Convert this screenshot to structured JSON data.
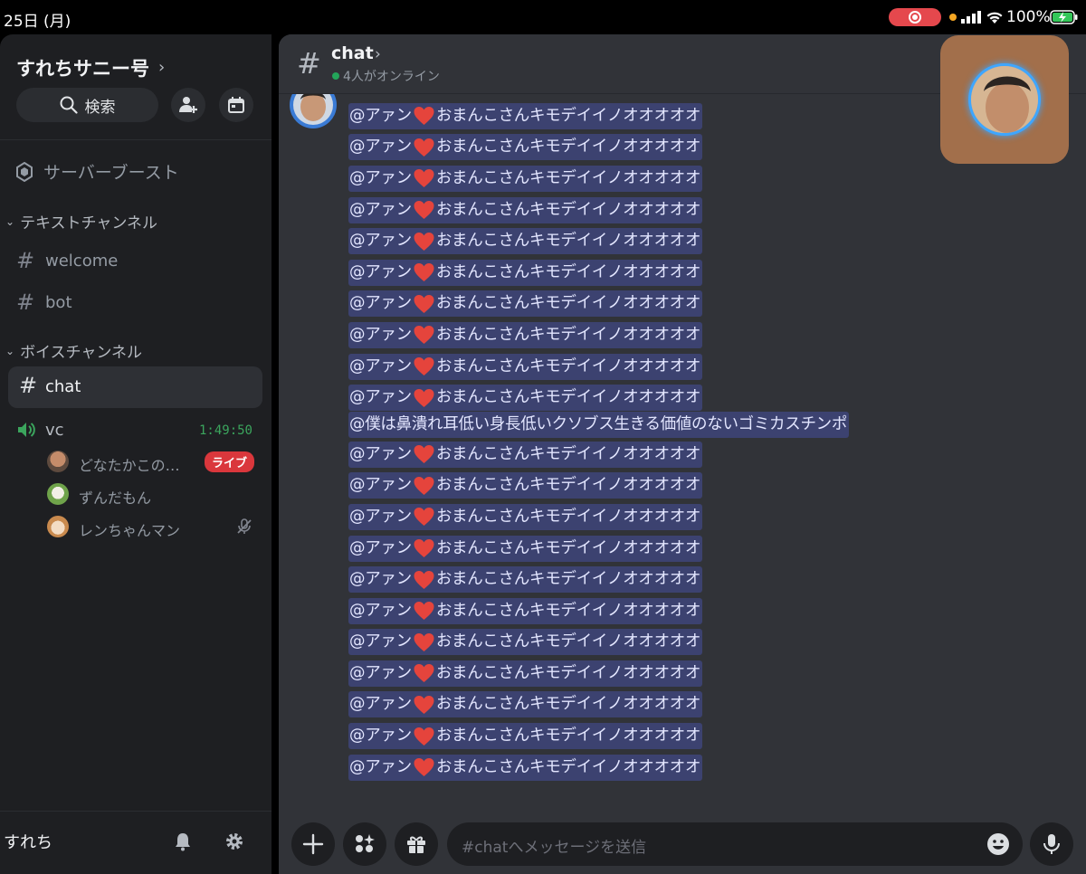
{
  "status_bar": {
    "date": "25日 (月)",
    "battery": "100%"
  },
  "sidebar": {
    "server_name": "すれちサニー号",
    "search_label": "検索",
    "boost_label": "サーバーブースト",
    "text_category": "テキストチャンネル",
    "voice_category": "ボイスチャンネル",
    "text_channels": [
      {
        "label": "welcome"
      },
      {
        "label": "bot"
      }
    ],
    "active_channel": "chat",
    "voice_channel": {
      "label": "vc",
      "timer": "1:49:50"
    },
    "voice_users": [
      {
        "name": "どなたかこの…",
        "badge": "ライブ"
      },
      {
        "name": "ずんだもん"
      },
      {
        "name": "レンちゃんマン"
      }
    ],
    "username": "すれち"
  },
  "chat": {
    "title": "chat",
    "online": "4人がオンライン",
    "messages": [
      {
        "prefix": "@アァン",
        "heart": true,
        "suffix": "おまんこさんキモデイイノオオオオオ"
      },
      {
        "prefix": "@アァン",
        "heart": true,
        "suffix": "おまんこさんキモデイイノオオオオオ"
      },
      {
        "prefix": "@アァン",
        "heart": true,
        "suffix": "おまんこさんキモデイイノオオオオオ"
      },
      {
        "prefix": "@アァン",
        "heart": true,
        "suffix": "おまんこさんキモデイイノオオオオオ"
      },
      {
        "prefix": "@アァン",
        "heart": true,
        "suffix": "おまんこさんキモデイイノオオオオオ"
      },
      {
        "prefix": "@アァン",
        "heart": true,
        "suffix": "おまんこさんキモデイイノオオオオオ"
      },
      {
        "prefix": "@アァン",
        "heart": true,
        "suffix": "おまんこさんキモデイイノオオオオオ"
      },
      {
        "prefix": "@アァン",
        "heart": true,
        "suffix": "おまんこさんキモデイイノオオオオオ"
      },
      {
        "prefix": "@アァン",
        "heart": true,
        "suffix": "おまんこさんキモデイイノオオオオオ"
      },
      {
        "prefix": "@アァン",
        "heart": true,
        "suffix": "おまんこさんキモデイイノオオオオオ"
      },
      {
        "prefix": "@僕は鼻潰れ耳低い身長低いクソブス生きる価値のないゴミカスチンポ",
        "heart": false,
        "suffix": ""
      },
      {
        "prefix": "@アァン",
        "heart": true,
        "suffix": "おまんこさんキモデイイノオオオオオ"
      },
      {
        "prefix": "@アァン",
        "heart": true,
        "suffix": "おまんこさんキモデイイノオオオオオ"
      },
      {
        "prefix": "@アァン",
        "heart": true,
        "suffix": "おまんこさんキモデイイノオオオオオ"
      },
      {
        "prefix": "@アァン",
        "heart": true,
        "suffix": "おまんこさんキモデイイノオオオオオ"
      },
      {
        "prefix": "@アァン",
        "heart": true,
        "suffix": "おまんこさんキモデイイノオオオオオ"
      },
      {
        "prefix": "@アァン",
        "heart": true,
        "suffix": "おまんこさんキモデイイノオオオオオ"
      },
      {
        "prefix": "@アァン",
        "heart": true,
        "suffix": "おまんこさんキモデイイノオオオオオ"
      },
      {
        "prefix": "@アァン",
        "heart": true,
        "suffix": "おまんこさんキモデイイノオオオオオ"
      },
      {
        "prefix": "@アァン",
        "heart": true,
        "suffix": "おまんこさんキモデイイノオオオオオ"
      },
      {
        "prefix": "@アァン",
        "heart": true,
        "suffix": "おまんこさんキモデイイノオオオオオ"
      },
      {
        "prefix": "@アァン",
        "heart": true,
        "suffix": "おまんこさんキモデイイノオオオオオ"
      }
    ],
    "composer_placeholder": "#chatへメッセージを送信"
  },
  "colors": {
    "sidebar_bg": "#1e1f22",
    "main_bg": "#313338",
    "mention_bg": "#3c4270",
    "live_red": "#da373c",
    "voice_green": "#3ba55d",
    "record_red": "#e5484d"
  },
  "icons": [
    "search-icon",
    "add-member-icon",
    "calendar-icon",
    "boost-icon",
    "speaker-icon",
    "mic-muted-icon",
    "bell-icon",
    "gear-icon",
    "plus-icon",
    "apps-icon",
    "gift-icon",
    "emoji-icon",
    "mic-icon",
    "heart-emoji"
  ]
}
